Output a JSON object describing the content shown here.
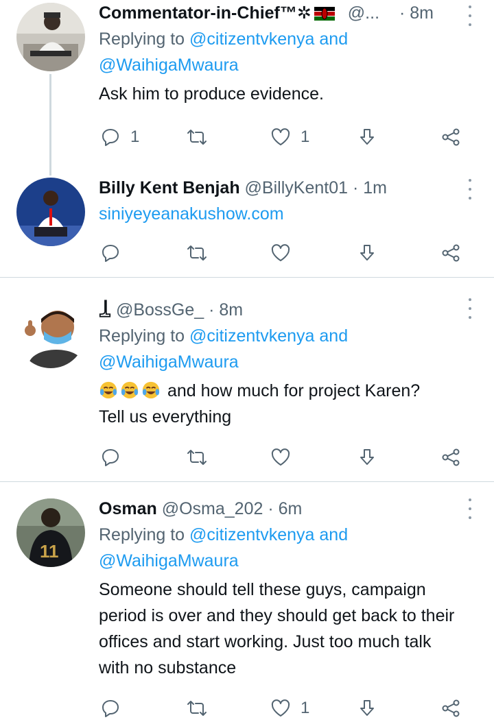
{
  "colors": {
    "link": "#1d9bf0",
    "secondary": "#536471",
    "divider": "#cfd9de"
  },
  "tweets": [
    {
      "name": "Commentator-in-Chief™",
      "handle": "@...",
      "sep": "·",
      "time": "8m",
      "reply_prefix": "Replying to",
      "mention1": "@citizentvkenya",
      "reply_and": "and",
      "mention2": "@WaihigaMwaura",
      "text": "Ask him to produce evidence.",
      "reply_count": "1",
      "like_count": "1"
    },
    {
      "name": "Billy Kent Benjah",
      "handle": "@BillyKent01",
      "sep": "·",
      "time": "1m",
      "link": "siniyeyeanakushow.com"
    },
    {
      "name": "",
      "handle": "@BossGe_",
      "sep": "·",
      "time": "8m",
      "reply_prefix": "Replying to",
      "mention1": "@citizentvkenya",
      "reply_and": "and",
      "mention2": "@WaihigaMwaura",
      "text_line1": "and how much for project Karen?",
      "text_line2": "Tell us everything"
    },
    {
      "name": "Osman",
      "handle": "@Osma_202",
      "sep": "·",
      "time": "6m",
      "reply_prefix": "Replying to",
      "mention1": "@citizentvkenya",
      "reply_and": "and",
      "mention2": "@WaihigaMwaura",
      "text": "Someone should tell these guys, campaign period is over and they should get back to their offices and start working. Just too much talk with no substance",
      "like_count": "1"
    }
  ]
}
